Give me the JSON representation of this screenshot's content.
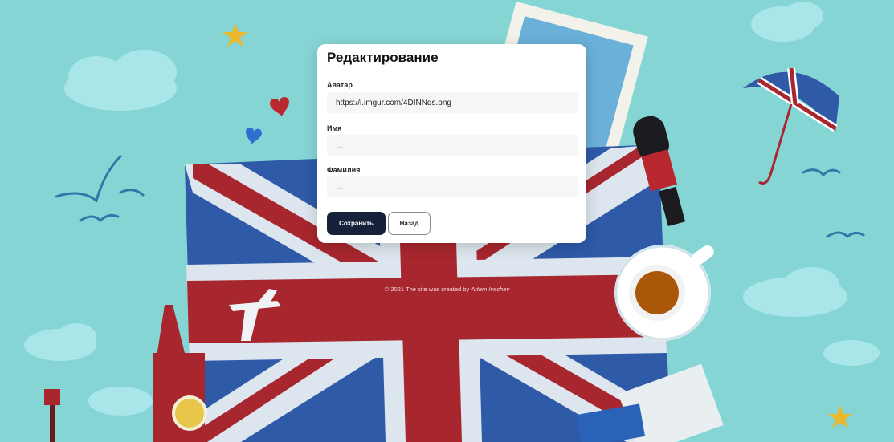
{
  "colors": {
    "background": "#86d5d5",
    "flag_blue": "#2e5aa8",
    "flag_red": "#a8262e",
    "primary_button": "#17223a"
  },
  "form": {
    "title": "Редактирование",
    "fields": [
      {
        "label": "Аватар",
        "value": "https://i.imgur.com/4DINNqs.png",
        "placeholder": ""
      },
      {
        "label": "Имя",
        "value": "",
        "placeholder": "..."
      },
      {
        "label": "Фамилия",
        "value": "",
        "placeholder": "..."
      }
    ],
    "save_label": "Сохранить",
    "back_label": "Назад"
  },
  "footer": {
    "prefix": "© 2021 The site was created by ",
    "author": "Artem Ivachev"
  }
}
